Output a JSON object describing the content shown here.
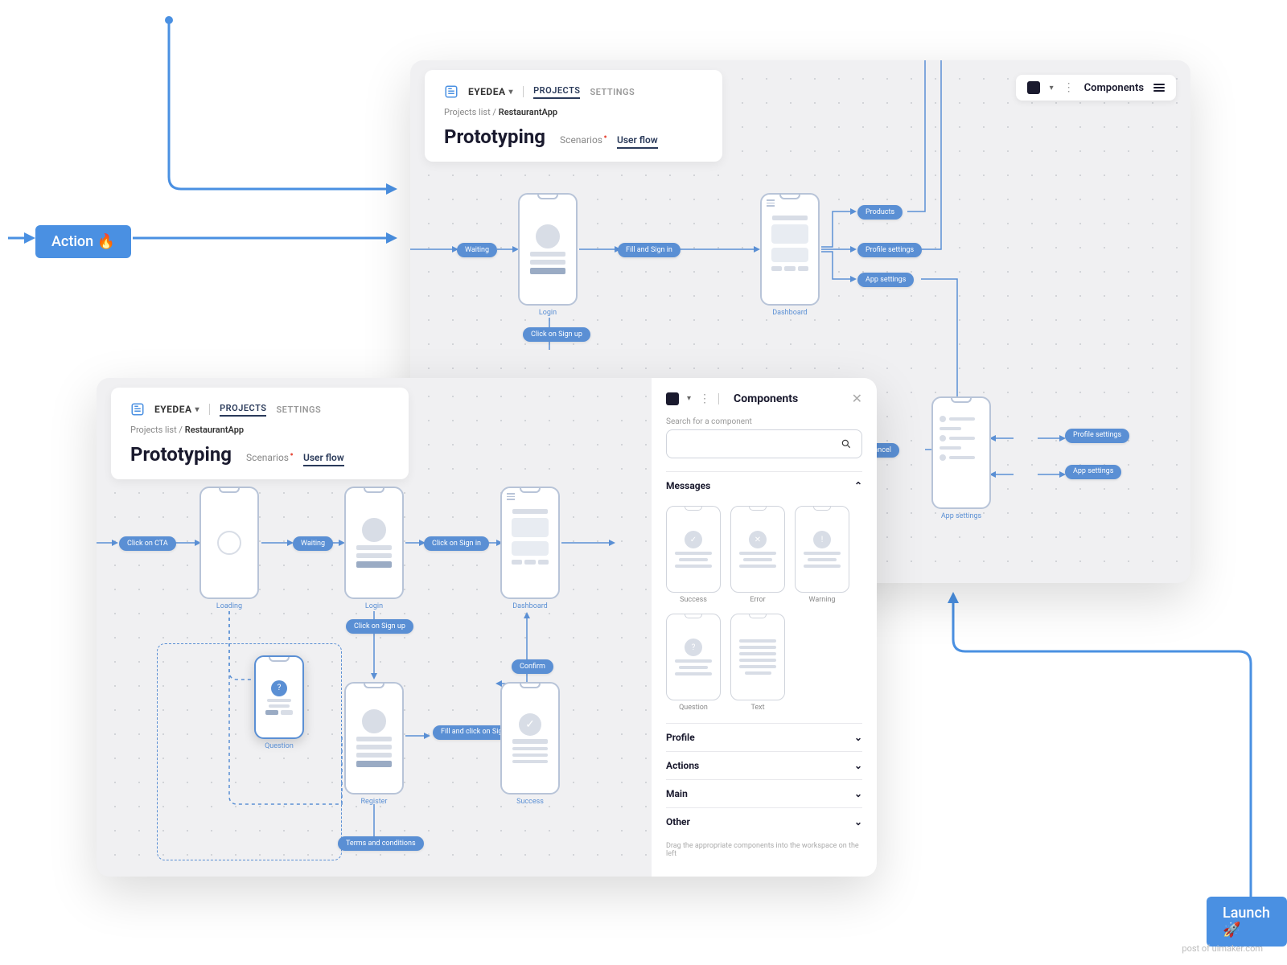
{
  "annotations": {
    "action": "Action 🔥",
    "launch": "Launch 🚀"
  },
  "app": {
    "brand": "EYEDEA",
    "nav": {
      "projects": "PROJECTS",
      "settings": "SETTINGS"
    },
    "breadcrumb": {
      "root": "Projects list",
      "current": "RestaurantApp",
      "sep": "/"
    },
    "page_title": "Prototyping",
    "tabs": {
      "scenarios": "Scenarios",
      "userflow": "User flow"
    },
    "toolbar": {
      "components": "Components"
    }
  },
  "flow_back": {
    "tags": {
      "waiting": "Waiting",
      "fillsign": "Fill and Sign in",
      "products": "Products",
      "profile": "Profile settings",
      "appset": "App settings",
      "click_signup": "Click on Sign up",
      "save": "Save changes / cancel",
      "profile2": "Profile\nsettings",
      "app2": "App\nsettings"
    },
    "screens": {
      "login": "Login",
      "dashboard": "Dashboard",
      "appsettings": "App settings"
    }
  },
  "flow_front": {
    "tags": {
      "cta": "Click on CTA",
      "waiting": "Waiting",
      "signin": "Click on Sign in",
      "signup": "Click on Sign up",
      "fillclick": "Fill and click\non Sign up",
      "confirm": "Confirm",
      "terms": "Terms and conditions"
    },
    "screens": {
      "loading": "Loading",
      "login": "Login",
      "dashboard": "Dashboard",
      "question": "Question",
      "register": "Register",
      "success": "Success"
    }
  },
  "panel": {
    "title": "Components",
    "search_label": "Search for a component",
    "sections": {
      "messages": "Messages",
      "profile": "Profile",
      "actions": "Actions",
      "main": "Main",
      "other": "Other"
    },
    "components": {
      "success": "Success",
      "error": "Error",
      "warning": "Warning",
      "question": "Question",
      "text": "Text"
    },
    "hint": "Drag the appropriate components into the workspace on the left"
  },
  "footer": "post of uimaker.com"
}
